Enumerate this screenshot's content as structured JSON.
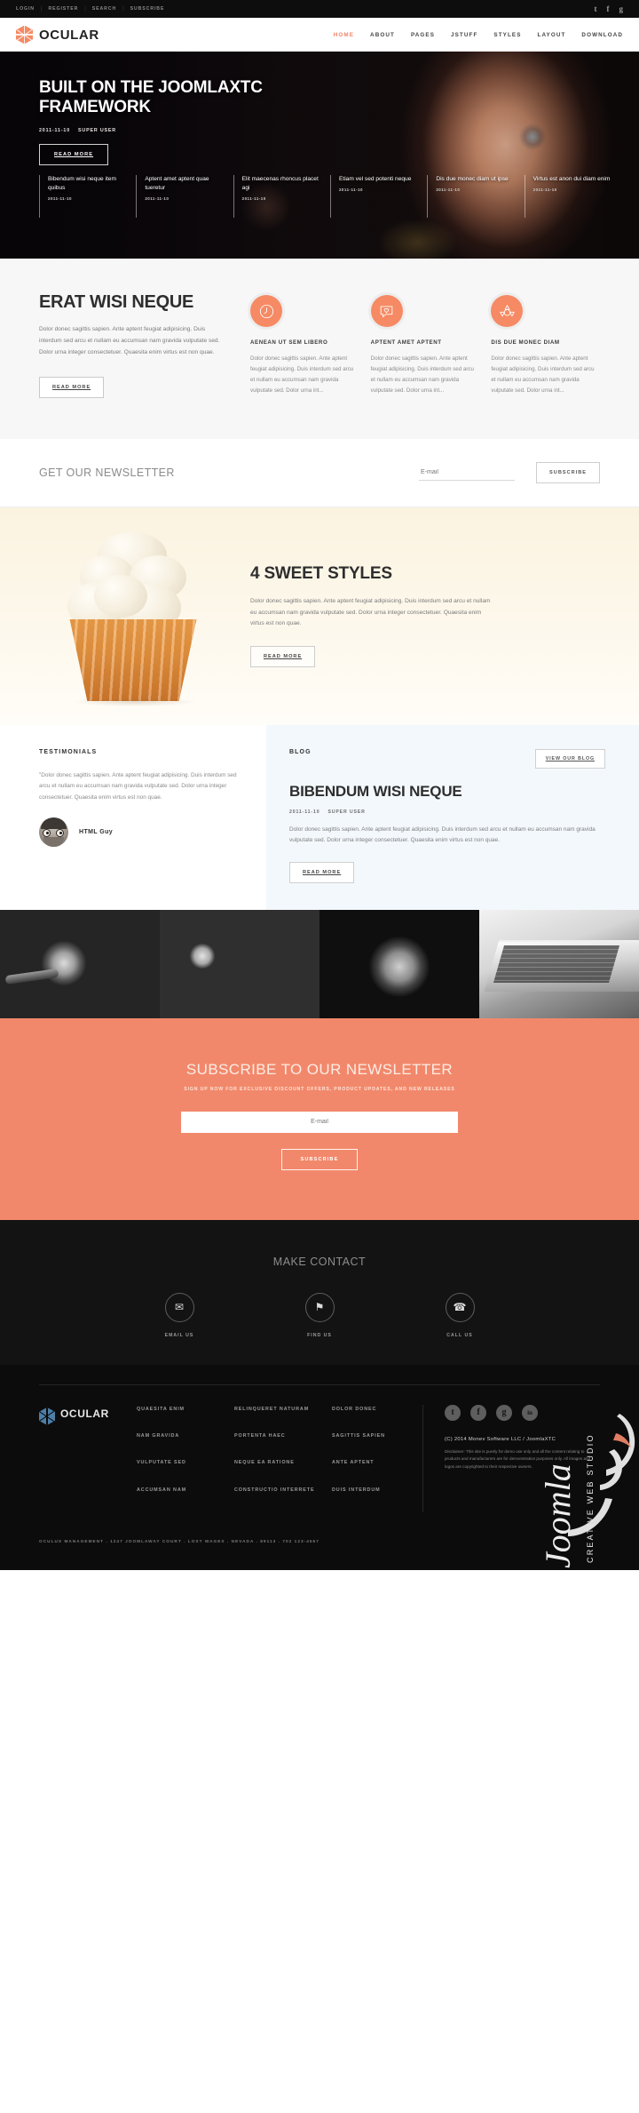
{
  "topbar": {
    "links": [
      "LOGIN",
      "REGISTER",
      "SEARCH",
      "SUBSCRIBE"
    ],
    "social": [
      {
        "name": "twitter-icon",
        "glyph": "t"
      },
      {
        "name": "facebook-icon",
        "glyph": "f"
      },
      {
        "name": "googleplus-icon",
        "glyph": "g"
      }
    ]
  },
  "header": {
    "brand": "OCULAR",
    "nav": [
      {
        "label": "HOME",
        "active": true
      },
      {
        "label": "ABOUT",
        "active": false
      },
      {
        "label": "PAGES",
        "active": false
      },
      {
        "label": "JSTUFF",
        "active": false
      },
      {
        "label": "STYLES",
        "active": false
      },
      {
        "label": "LAYOUT",
        "active": false
      },
      {
        "label": "DOWNLOAD",
        "active": false
      }
    ]
  },
  "hero": {
    "title": "BUILT ON THE JOOMLAXTC FRAMEWORK",
    "date": "2011-11-10",
    "author": "SUPER USER",
    "button": "READ MORE",
    "strip": [
      {
        "title": "Bibendum wisi neque item quibus",
        "date": "2011-11-10"
      },
      {
        "title": "Aptent amet aptent quae tueretur",
        "date": "2011-11-10"
      },
      {
        "title": "Elit maecenas rhoncus placet agi",
        "date": "2011-11-10"
      },
      {
        "title": "Etiam vel sed potenti neque",
        "date": "2011-11-10"
      },
      {
        "title": "Dis due monec diam ut ipse",
        "date": "2011-11-10"
      },
      {
        "title": "Virtus est anon dui diam enim",
        "date": "2011-11-10"
      }
    ]
  },
  "features": {
    "heading": "ERAT WISI NEQUE",
    "paragraph": "Dolor donec sagittis sapien. Ante aptent feugiat adipisicing. Duis interdum sed arcu et nullam eu accumsan nam gravida vulputate sed. Dolor urna integer consectetuer. Quaesita enim virtus est non quae.",
    "button": "READ MORE",
    "columns": [
      {
        "icon": "clock-icon",
        "title": "AENEAN UT SEM LIBERO",
        "text": "Dolor donec sagittis sapien. Ante aptent feugiat adipisicing. Duis interdum sed arcu et nullam eu accumsan nam gravida vulputate sed. Dolor urna int..."
      },
      {
        "icon": "heart-comment-icon",
        "title": "APTENT AMET APTENT",
        "text": "Dolor donec sagittis sapien. Ante aptent feugiat adipisicing. Duis interdum sed arcu et nullam eu accumsan nam gravida vulputate sed. Dolor urna int..."
      },
      {
        "icon": "recycle-icon",
        "title": "DIS DUE MONEC DIAM",
        "text": "Dolor donec sagittis sapien. Ante aptent feugiat adipisicing. Duis interdum sed arcu et nullam eu accumsan nam gravida vulputate sed. Dolor urna int..."
      }
    ]
  },
  "newsletter": {
    "heading": "GET OUR NEWSLETTER",
    "placeholder": "E-mail",
    "button": "SUBSCRIBE"
  },
  "sweet": {
    "heading": "4 SWEET STYLES",
    "paragraph": "Dolor donec sagittis sapien. Ante aptent feugiat adipisicing. Duis interdum sed arcu et nullam eu accumsan nam gravida vulputate sed. Dolor urna integer consectetuer. Quaesita enim virtus est non quae.",
    "button": "READ MORE"
  },
  "testimonials": {
    "label": "TESTIMONIALS",
    "quote": "\"Dolor donec sagittis sapien. Ante aptent feugiat adipisicing. Duis interdum sed arcu et nullam eu accumsan nam gravida vulputate sed. Dolor urna integer consectetuer. Quaesita enim virtus est non quae.",
    "author": "HTML Guy"
  },
  "blog": {
    "label": "BLOG",
    "view_button": "VIEW OUR BLOG",
    "heading": "BIBENDUM WISI NEQUE",
    "date": "2011-11-10",
    "author": "SUPER USER",
    "paragraph": "Dolor donec sagittis sapien. Ante aptent feugiat adipisicing. Duis interdum sed arcu et nullam eu accumsan nam gravida vulputate sed. Dolor urna integer consectetuer. Quaesita enim virtus est non quae.",
    "button": "READ MORE"
  },
  "gallery": [
    {
      "name": "gallery-image-valve"
    },
    {
      "name": "gallery-image-gauges"
    },
    {
      "name": "gallery-image-fan"
    },
    {
      "name": "gallery-image-laptop"
    }
  ],
  "cta": {
    "heading": "SUBSCRIBE TO OUR NEWSLETTER",
    "subheading": "SIGN UP NOW FOR EXCLUSIVE DISCOUNT OFFERS, PRODUCT UPDATES, AND NEW RELEASES",
    "placeholder": "E-mail",
    "button": "SUBSCRIBE"
  },
  "contact": {
    "heading": "MAKE CONTACT",
    "items": [
      {
        "icon": "envelope-icon",
        "glyph": "✉",
        "label": "EMAIL US"
      },
      {
        "icon": "map-pin-icon",
        "glyph": "⚑",
        "label": "FIND US"
      },
      {
        "icon": "phone-icon",
        "glyph": "☎",
        "label": "CALL US"
      }
    ]
  },
  "footer": {
    "brand": "OCULAR",
    "columns": [
      [
        "QUAESITA ENIM",
        "NAM GRAVIDA",
        "VULPUTATE SED",
        "ACCUMSAN NAM"
      ],
      [
        "RELINQUERET NATURAM",
        "PORTENTA HAEC",
        "NEQUE EA RATIONE",
        "CONSTRUCTIO INTERRETE"
      ],
      [
        "DOLOR DONEC",
        "SAGITTIS SAPIEN",
        "ANTE APTENT",
        "DUIS INTERDUM"
      ]
    ],
    "social": [
      {
        "name": "twitter-icon",
        "glyph": "t"
      },
      {
        "name": "facebook-icon",
        "glyph": "f"
      },
      {
        "name": "googleplus-icon",
        "glyph": "g"
      },
      {
        "name": "linkedin-icon",
        "glyph": "in"
      }
    ],
    "copyright": "(C) 2014 Monev Software LLC / JoomlaXTC",
    "disclaimer": "Disclaimer: This site is purely for demo use only and all the content relating to products and manufacturers are for demonstration purposes only. All images and logos are copyrighted to their respective owners.",
    "address": "OCULUS MANAGEMENT . 1247 JOOMLAWAY COURT . LOST WAGES . NEVADA . 89113 . 702 123-4567",
    "watermark": "JoomlaFox",
    "watermark_sub": "CREATIVE WEB STUDIO"
  },
  "colors": {
    "accent": "#f2886b",
    "dark": "#0d0d0d",
    "footer_bg": "#0c0c0c",
    "light_bg": "#f7f7f7",
    "blog_bg": "#f3f8fc",
    "sweet_bg": "#fbf3e0"
  }
}
